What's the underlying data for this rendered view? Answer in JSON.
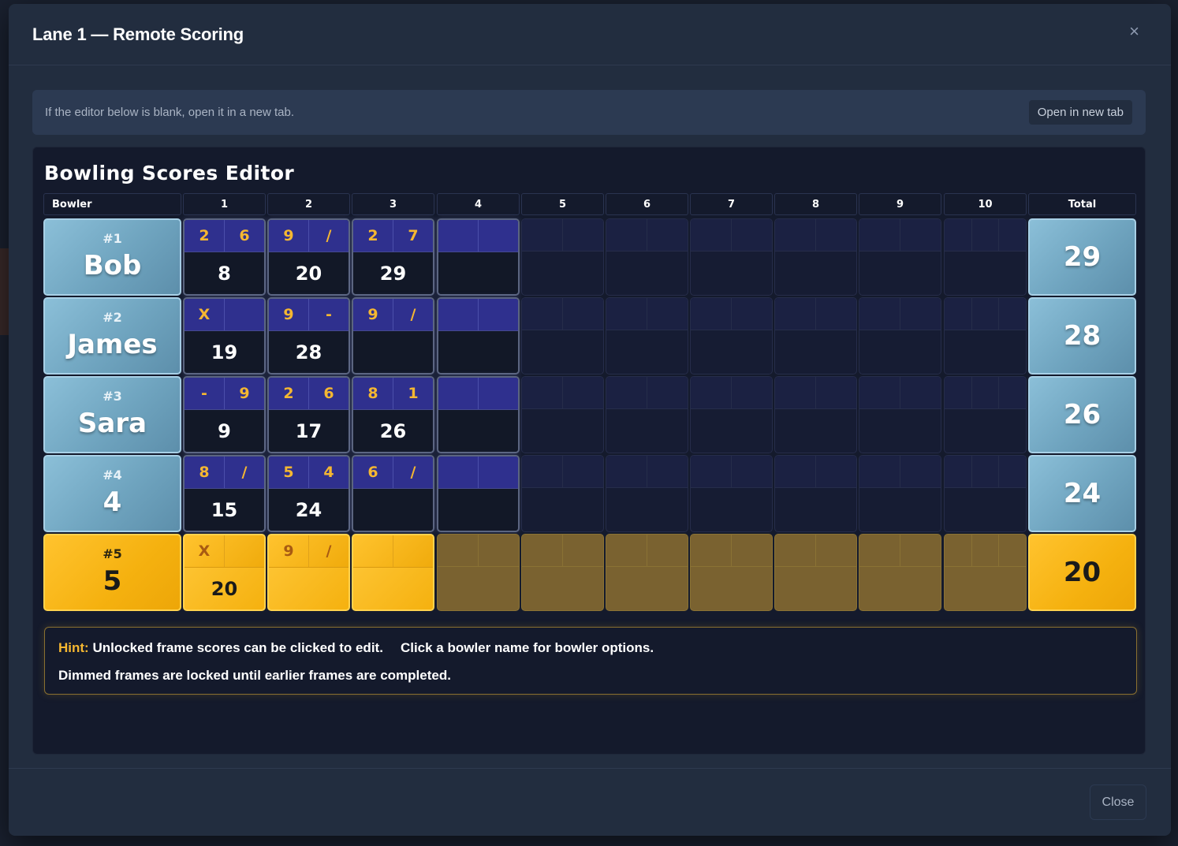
{
  "modal": {
    "title": "Lane 1 — Remote Scoring",
    "close_icon": "×",
    "notice_text": "If the editor below is blank, open it in a new tab.",
    "open_new_tab_label": "Open in new tab",
    "close_label": "Close"
  },
  "editor": {
    "title": "Bowling Scores Editor",
    "header_bowler": "Bowler",
    "header_frames": [
      "1",
      "2",
      "3",
      "4",
      "5",
      "6",
      "7",
      "8",
      "9",
      "10"
    ],
    "header_total": "Total",
    "bowlers": [
      {
        "num": "#1",
        "name": "Bob",
        "total": "29",
        "active": false,
        "frames": [
          {
            "b1": "2",
            "b2": "6",
            "cum": "8"
          },
          {
            "b1": "9",
            "b2": "/",
            "cum": "20"
          },
          {
            "b1": "2",
            "b2": "7",
            "cum": "29"
          },
          {
            "b1": "",
            "b2": "",
            "cum": ""
          }
        ]
      },
      {
        "num": "#2",
        "name": "James",
        "total": "28",
        "active": false,
        "frames": [
          {
            "b1": "X",
            "b2": "",
            "cum": "19"
          },
          {
            "b1": "9",
            "b2": "-",
            "cum": "28"
          },
          {
            "b1": "9",
            "b2": "/",
            "cum": ""
          },
          {
            "b1": "",
            "b2": "",
            "cum": ""
          }
        ]
      },
      {
        "num": "#3",
        "name": "Sara",
        "total": "26",
        "active": false,
        "frames": [
          {
            "b1": "-",
            "b2": "9",
            "cum": "9"
          },
          {
            "b1": "2",
            "b2": "6",
            "cum": "17"
          },
          {
            "b1": "8",
            "b2": "1",
            "cum": "26"
          },
          {
            "b1": "",
            "b2": "",
            "cum": ""
          }
        ]
      },
      {
        "num": "#4",
        "name": "4",
        "total": "24",
        "active": false,
        "frames": [
          {
            "b1": "8",
            "b2": "/",
            "cum": "15"
          },
          {
            "b1": "5",
            "b2": "4",
            "cum": "24"
          },
          {
            "b1": "6",
            "b2": "/",
            "cum": ""
          },
          {
            "b1": "",
            "b2": "",
            "cum": ""
          }
        ]
      },
      {
        "num": "#5",
        "name": "5",
        "total": "20",
        "active": true,
        "frames": [
          {
            "b1": "X",
            "b2": "",
            "cum": "20"
          },
          {
            "b1": "9",
            "b2": "/",
            "cum": ""
          },
          {
            "b1": "",
            "b2": "",
            "cum": ""
          }
        ]
      }
    ],
    "hint": {
      "label": "Hint:",
      "text1": "Unlocked frame scores can be clicked to edit.",
      "text2": "Click a bowler name for bowler options.",
      "text3": "Dimmed frames are locked until earlier frames are completed."
    }
  }
}
